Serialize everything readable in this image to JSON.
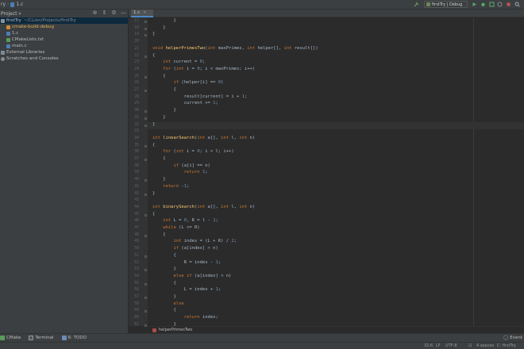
{
  "topbar": {
    "project": "ry",
    "file": "1.c",
    "run_config": "firstTry | Debug"
  },
  "project_panel": {
    "header": "Project",
    "tree": [
      {
        "label": "firstTry",
        "detail": "~/CLion/Projects/firstTry",
        "icon": "folder-icon",
        "selected": true
      },
      {
        "label": "cmake-build-debug",
        "icon": "folder-orange-icon",
        "orange": true
      },
      {
        "label": "1.c",
        "icon": "c-file-icon"
      },
      {
        "label": "CMakeLists.txt",
        "icon": "cmake-file-icon"
      },
      {
        "label": "main.c",
        "icon": "c-file-icon"
      },
      {
        "label": "External Libraries",
        "icon": "library-icon"
      },
      {
        "label": "Scratches and Consoles",
        "icon": "scratch-icon"
      }
    ]
  },
  "editor": {
    "tab_label": "1.c",
    "current_line": 32,
    "lines": [
      {
        "n": "17",
        "code": "        }"
      },
      {
        "n": "18",
        "code": "    }"
      },
      {
        "n": "19",
        "code": "}"
      },
      {
        "n": "20",
        "code": ""
      },
      {
        "n": "21",
        "code": "void helperPrimesTwo(int maxPrimes, int helper[], int result[])"
      },
      {
        "n": "22",
        "code": "{"
      },
      {
        "n": "23",
        "code": "    int current = 0;"
      },
      {
        "n": "24",
        "code": "    for (int i = 0; i < maxPrimes; i++)"
      },
      {
        "n": "25",
        "code": "    {"
      },
      {
        "n": "26",
        "code": "        if (helper[i] == 0)"
      },
      {
        "n": "27",
        "code": "        {"
      },
      {
        "n": "28",
        "code": "            result[current] = i + 1;"
      },
      {
        "n": "29",
        "code": "            current += 1;"
      },
      {
        "n": "30",
        "code": "        }"
      },
      {
        "n": "31",
        "code": "    }"
      },
      {
        "n": "32",
        "code": "}"
      },
      {
        "n": "33",
        "code": ""
      },
      {
        "n": "34",
        "code": "int linearSearch(int a[], int l, int n)"
      },
      {
        "n": "35",
        "code": "{"
      },
      {
        "n": "36",
        "code": "    for (int i = 0; i < l; i++)"
      },
      {
        "n": "37",
        "code": "    {"
      },
      {
        "n": "38",
        "code": "        if (a[i] == n)"
      },
      {
        "n": "39",
        "code": "            return 1;"
      },
      {
        "n": "40",
        "code": "    }"
      },
      {
        "n": "41",
        "code": "    return -1;"
      },
      {
        "n": "42",
        "code": "}"
      },
      {
        "n": "43",
        "code": ""
      },
      {
        "n": "44",
        "code": "int binarySearch(int a[], int l, int n)"
      },
      {
        "n": "45",
        "code": "{"
      },
      {
        "n": "46",
        "code": "    int L = 0, R = l - 1;"
      },
      {
        "n": "47",
        "code": "    while (L <= R)"
      },
      {
        "n": "48",
        "code": "    {"
      },
      {
        "n": "49",
        "code": "        int index = (L + R) / 2;"
      },
      {
        "n": "50",
        "code": "        if (a[index] > n)"
      },
      {
        "n": "51",
        "code": "        {"
      },
      {
        "n": "52",
        "code": "            R = index - 1;"
      },
      {
        "n": "53",
        "code": "        }"
      },
      {
        "n": "54",
        "code": "        else if (a[index] < n)"
      },
      {
        "n": "55",
        "code": "        {"
      },
      {
        "n": "56",
        "code": "            L = index + 1;"
      },
      {
        "n": "57",
        "code": "        }"
      },
      {
        "n": "58",
        "code": "        else"
      },
      {
        "n": "59",
        "code": "        {"
      },
      {
        "n": "60",
        "code": "            return index;"
      },
      {
        "n": "61",
        "code": "        }"
      }
    ],
    "breadcrumb": "helperPrimesTwo"
  },
  "tool_windows": {
    "cmake": "CMake",
    "terminal": "Terminal",
    "todo": "6: TODO",
    "event_log": "Event"
  },
  "statusbar": {
    "position": "32:6",
    "line_sep": "LF",
    "encoding": "UTF-8",
    "indent": "4 spaces",
    "context": "C: firstTry"
  },
  "colors": {
    "keyword": "#cc7832",
    "number": "#6897bb",
    "function": "#ffc66d",
    "text": "#a9b7c6",
    "background": "#2b2b2b",
    "panel": "#3c3f41",
    "selection": "#0d293e"
  }
}
